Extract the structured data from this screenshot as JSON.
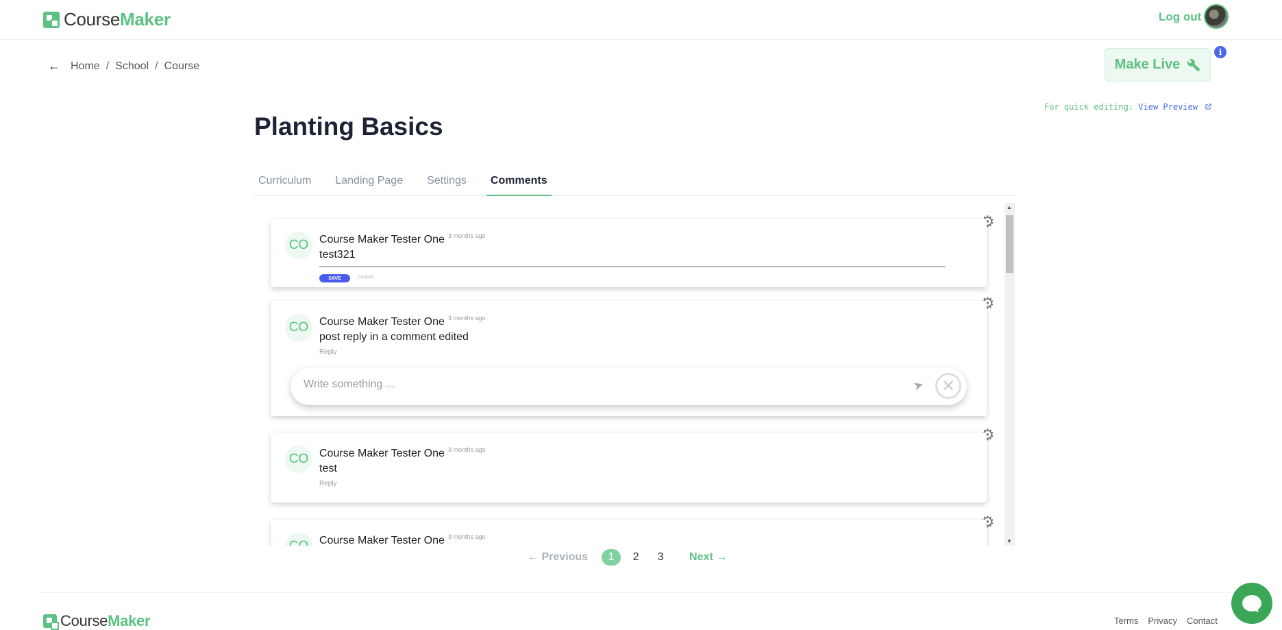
{
  "header": {
    "logo_part1": "Course",
    "logo_part2": "Maker",
    "logout_label": "Log out"
  },
  "breadcrumb": {
    "items": [
      "Home",
      "School",
      "Course"
    ],
    "separator": "/"
  },
  "actions": {
    "make_live_label": "Make Live",
    "info_icon": "i",
    "quick_edit_prefix": "For quick editing:",
    "view_preview_label": "View Preview"
  },
  "course": {
    "title": "Planting Basics"
  },
  "tabs": [
    {
      "label": "Curriculum",
      "active": false
    },
    {
      "label": "Landing Page",
      "active": false
    },
    {
      "label": "Settings",
      "active": false
    },
    {
      "label": "Comments",
      "active": true
    }
  ],
  "comments": [
    {
      "initials": "CO",
      "author": "Course Maker Tester One",
      "time": "3 months ago",
      "body": "test321",
      "mode": "editing",
      "save_label": "SAVE",
      "cancel_label": "CANCEL"
    },
    {
      "initials": "CO",
      "author": "Course Maker Tester One",
      "time": "3 months ago",
      "body": "post reply in a comment edited",
      "reply_label": "Reply",
      "reply_box": {
        "placeholder": "Write something ..."
      }
    },
    {
      "initials": "CO",
      "author": "Course Maker Tester One",
      "time": "3 months ago",
      "body": "test",
      "reply_label": "Reply"
    },
    {
      "initials": "CO",
      "author": "Course Maker Tester One",
      "time": "3 months ago"
    }
  ],
  "pagination": {
    "prev_label": "← Previous",
    "pages": [
      "1",
      "2",
      "3"
    ],
    "current": "1",
    "next_label": "Next →"
  },
  "footer": {
    "logo_part1": "Course",
    "logo_part2": "Maker",
    "links": [
      "Terms",
      "Privacy",
      "Contact"
    ]
  },
  "colors": {
    "brand_green": "#5cc183",
    "accent_blue": "#4a68e8",
    "chat_green": "#3aa757"
  },
  "icons": [
    "back-arrow-icon",
    "wrench-icon",
    "info-icon",
    "external-link-icon",
    "gear-icon",
    "send-icon",
    "close-icon",
    "chat-icon"
  ]
}
